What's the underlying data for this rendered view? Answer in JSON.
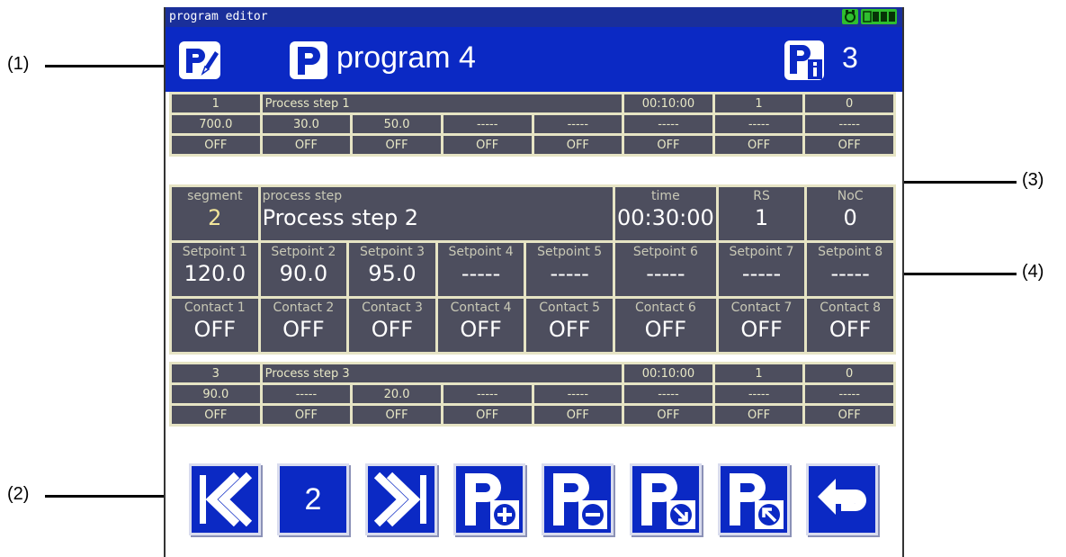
{
  "callouts": {
    "c1": "(1)",
    "c2": "(2)",
    "c3": "(3)",
    "c4": "(4)"
  },
  "window": {
    "title": "program editor",
    "status_icons": [
      "power-icon",
      "battery-icon"
    ]
  },
  "header": {
    "edit_icon": "program-edit-icon",
    "program_icon": "program-icon",
    "program_title": "program 4",
    "info_icon": "program-info-icon",
    "program_count": "3"
  },
  "prev_step": {
    "segment": "1",
    "name": "Process step 1",
    "time": "00:10:00",
    "rs": "1",
    "noc": "0",
    "setpoints": [
      "700.0",
      "30.0",
      "50.0",
      "-----",
      "-----",
      "-----",
      "-----",
      "-----"
    ],
    "contacts": [
      "OFF",
      "OFF",
      "OFF",
      "OFF",
      "OFF",
      "OFF",
      "OFF",
      "OFF"
    ]
  },
  "current_step": {
    "labels": {
      "segment": "segment",
      "process_step": "process step",
      "time": "time",
      "rs": "RS",
      "noc": "NoC"
    },
    "segment": "2",
    "name": "Process step 2",
    "time": "00:30:00",
    "rs": "1",
    "noc": "0",
    "setpoint_labels": [
      "Setpoint 1",
      "Setpoint 2",
      "Setpoint 3",
      "Setpoint 4",
      "Setpoint 5",
      "Setpoint 6",
      "Setpoint 7",
      "Setpoint 8"
    ],
    "setpoints": [
      "120.0",
      "90.0",
      "95.0",
      "-----",
      "-----",
      "-----",
      "-----",
      "-----"
    ],
    "contact_labels": [
      "Contact 1",
      "Contact 2",
      "Contact 3",
      "Contact 4",
      "Contact 5",
      "Contact 6",
      "Contact 7",
      "Contact 8"
    ],
    "contacts": [
      "OFF",
      "OFF",
      "OFF",
      "OFF",
      "OFF",
      "OFF",
      "OFF",
      "OFF"
    ]
  },
  "next_step": {
    "segment": "3",
    "name": "Process step 3",
    "time": "00:10:00",
    "rs": "1",
    "noc": "0",
    "setpoints": [
      "90.0",
      "-----",
      "20.0",
      "-----",
      "-----",
      "-----",
      "-----",
      "-----"
    ],
    "contacts": [
      "OFF",
      "OFF",
      "OFF",
      "OFF",
      "OFF",
      "OFF",
      "OFF",
      "OFF"
    ]
  },
  "toolbar": {
    "current_segment": "2",
    "buttons": [
      "first-step-icon",
      "segment-number",
      "next-step-icon",
      "insert-step-icon",
      "delete-step-icon",
      "step-down-icon",
      "step-up-icon",
      "back-icon"
    ]
  },
  "colors": {
    "header_blue": "#0b29c4",
    "title_blue": "#1a2f9a",
    "cell_gray": "#4d4e5e",
    "cell_text": "#e8e8c6",
    "grid_bg": "#e6e4c4"
  }
}
